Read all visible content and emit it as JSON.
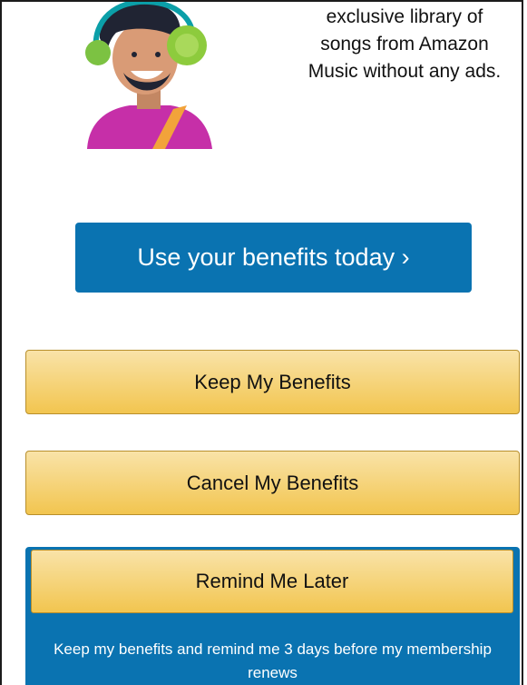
{
  "promo": {
    "line1": "exclusive library of",
    "line2": "songs from Amazon",
    "line3": "Music without any ads."
  },
  "cta": {
    "label": "Use your benefits today ›"
  },
  "actions": {
    "keep_label": "Keep My Benefits",
    "cancel_label": "Cancel My Benefits",
    "remind_label": "Remind Me Later",
    "remind_note": "Keep my benefits and remind me 3 days before my membership renews"
  },
  "colors": {
    "primary_blue": "#0a73b1",
    "button_yellow_top": "#f9e3a8",
    "button_yellow_bottom": "#f2c54f",
    "text_dark": "#111111"
  },
  "icons": {
    "illustration": "person-with-headphones-icon"
  }
}
